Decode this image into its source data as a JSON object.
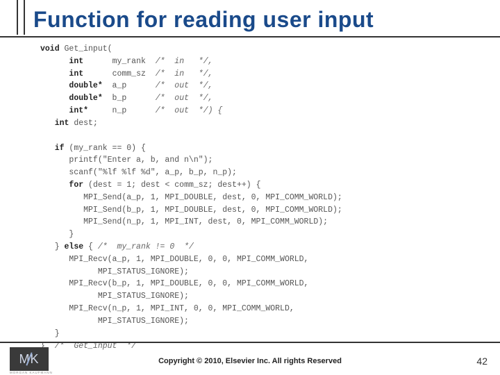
{
  "title": "Function for reading user input",
  "code": {
    "sig_kw": "void",
    "sig_name": " Get_input(",
    "params": [
      {
        "type": "int",
        "name": "my_rank",
        "comment": "/*  in   */,"
      },
      {
        "type": "int",
        "name": "comm_sz",
        "comment": "/*  in   */,"
      },
      {
        "type": "double*",
        "name": "a_p",
        "comment": "/*  out  */,"
      },
      {
        "type": "double*",
        "name": "b_p",
        "comment": "/*  out  */,"
      },
      {
        "type": "int*",
        "name": "n_p",
        "comment": "/*  out  */) {"
      }
    ],
    "decl_kw": "int",
    "decl_rest": " dest;",
    "if_kw": "if",
    "if_cond": " (my_rank == 0) {",
    "l_printf": "      printf(\"Enter a, b, and n\\n\");",
    "l_scanf": "      scanf(\"%lf %lf %d\", a_p, b_p, n_p);",
    "for_kw": "for",
    "for_cond": " (dest = 1; dest < comm_sz; dest++) {",
    "l_send_a": "         MPI_Send(a_p, 1, MPI_DOUBLE, dest, 0, MPI_COMM_WORLD);",
    "l_send_b": "         MPI_Send(b_p, 1, MPI_DOUBLE, dest, 0, MPI_COMM_WORLD);",
    "l_send_n": "         MPI_Send(n_p, 1, MPI_INT, dest, 0, MPI_COMM_WORLD);",
    "l_forend": "      }",
    "else_pre": "   } ",
    "else_kw": "else",
    "else_post": " { ",
    "else_cm": "/*  my_rank != 0  */",
    "l_recv_a1": "      MPI_Recv(a_p, 1, MPI_DOUBLE, 0, 0, MPI_COMM_WORLD,",
    "l_recv_a2": "            MPI_STATUS_IGNORE);",
    "l_recv_b1": "      MPI_Recv(b_p, 1, MPI_DOUBLE, 0, 0, MPI_COMM_WORLD,",
    "l_recv_b2": "            MPI_STATUS_IGNORE);",
    "l_recv_n1": "      MPI_Recv(n_p, 1, MPI_INT, 0, 0, MPI_COMM_WORLD,",
    "l_recv_n2": "            MPI_STATUS_IGNORE);",
    "l_elseend": "   }",
    "l_funend": "}  ",
    "l_funend_cm": "/*  Get_input  */"
  },
  "footer": {
    "copyright": "Copyright © 2010, Elsevier Inc. All rights Reserved",
    "page": "42",
    "logo_text": "MK",
    "logo_sub": "MORGAN KAUFMANN"
  }
}
